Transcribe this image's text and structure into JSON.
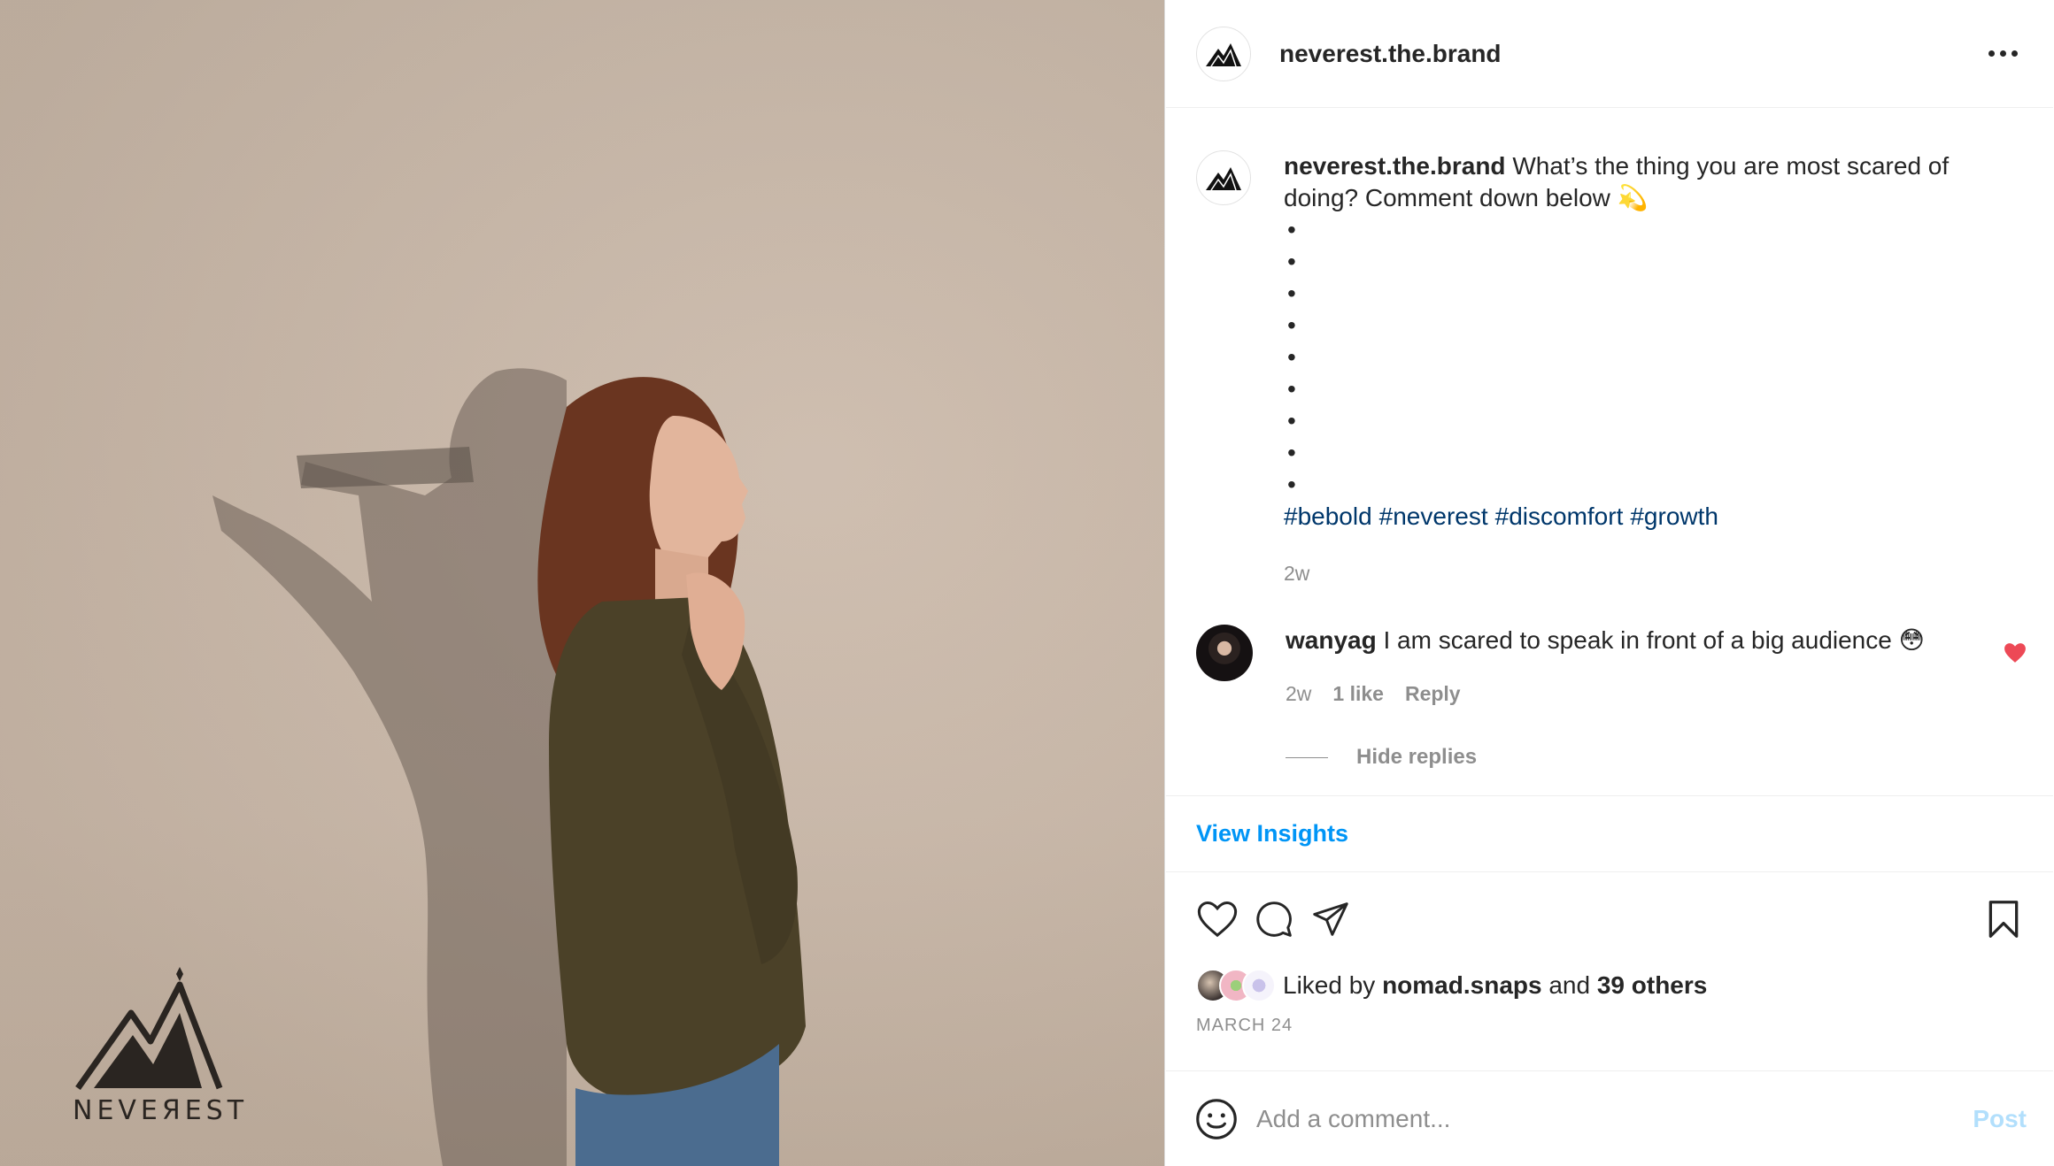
{
  "post": {
    "username": "neverest.the.brand",
    "brand_wordmark": "NEVEЯEST",
    "caption": {
      "username": "neverest.the.brand",
      "text": "What’s the thing you are most scared of doing? Comment down below 💫",
      "bullets": [
        "•",
        "•",
        "•",
        "•",
        "•",
        "•",
        "•",
        "•",
        "•"
      ],
      "hashtags": [
        "#bebold",
        "#neverest",
        "#discomfort",
        "#growth"
      ],
      "time": "2w"
    },
    "comment": {
      "username": "wanyag",
      "text": "I am scared to speak in front of a big audience 😳",
      "time": "2w",
      "likes": "1 like",
      "reply_label": "Reply",
      "hide_replies": "Hide replies"
    },
    "insights_label": "View Insights",
    "liked_by_prefix": "Liked by",
    "liked_by_user": "nomad.snaps",
    "liked_by_and": "and",
    "liked_by_others": "39 others",
    "date": "MARCH 24",
    "add_comment_placeholder": "Add a comment...",
    "post_button": "Post"
  },
  "colors": {
    "link": "#0095f6",
    "hashtag": "#00376b",
    "like_red": "#ed4956",
    "muted": "#8e8e8e"
  },
  "icons": [
    "more-horizontal-icon",
    "heart-icon",
    "comment-icon",
    "share-icon",
    "bookmark-icon",
    "emoji-icon",
    "small-heart-icon"
  ]
}
